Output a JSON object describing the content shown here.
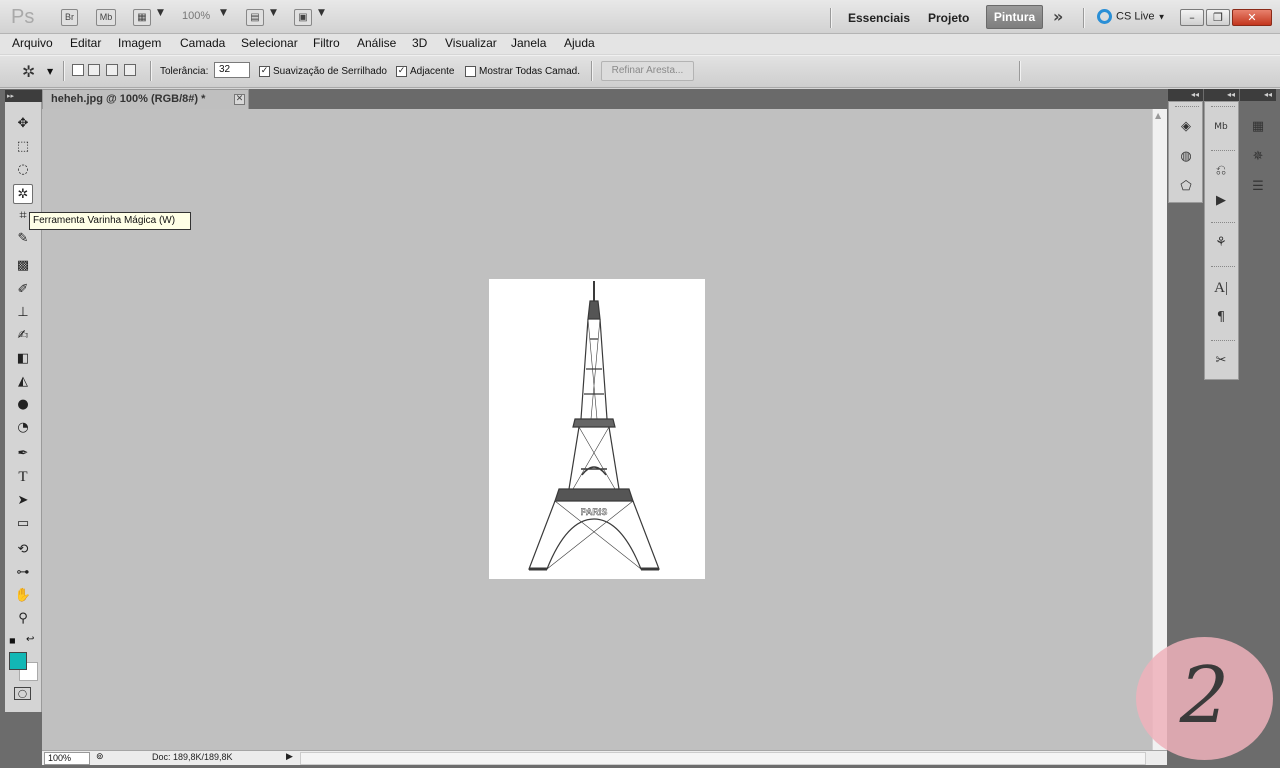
{
  "appbar": {
    "logo": "Ps",
    "bridge_label": "Br",
    "minibridge_label": "Mb",
    "zoom_value": "100%",
    "workspaces": [
      "Essenciais",
      "Projeto",
      "Pintura"
    ],
    "cs_live": "CS Live"
  },
  "menu": [
    "Arquivo",
    "Editar",
    "Imagem",
    "Camada",
    "Selecionar",
    "Filtro",
    "Análise",
    "3D",
    "Visualizar",
    "Janela",
    "Ajuda"
  ],
  "options": {
    "tolerance_label": "Tolerância:",
    "tolerance_value": "32",
    "antialias_label": "Suavização de Serrilhado",
    "antialias_checked": true,
    "contiguous_label": "Adjacente",
    "contiguous_checked": true,
    "sample_all_label": "Mostrar Todas Camad.",
    "sample_all_checked": false,
    "refine_label": "Refinar Aresta..."
  },
  "document": {
    "tab_title": "heheh.jpg @ 100% (RGB/8#) *",
    "image_label": "PARIS"
  },
  "tooltip": "Ferramenta Varinha Mágica (W)",
  "colors": {
    "foreground": "#12b7b5",
    "background": "#ffffff"
  },
  "status": {
    "zoom": "100%",
    "doc_size": "Doc: 189,8K/189,8K"
  },
  "badge": "2"
}
